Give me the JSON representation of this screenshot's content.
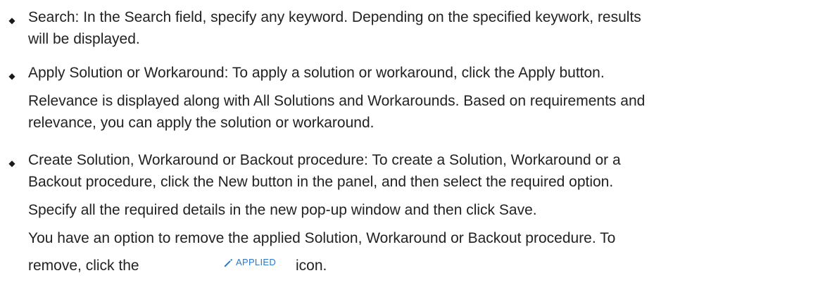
{
  "bullets": [
    {
      "lines": [
        " Search: In the Search field, specify any keyword. Depending on the specified keywork, results",
        "will be displayed."
      ]
    },
    {
      "lines": [
        "Apply Solution or Workaround: To apply a solution or workaround, click the Apply button."
      ],
      "paragraph_lines": [
        "Relevance is displayed along with All Solutions and Workarounds. Based on requirements and",
        "relevance, you can apply the solution or workaround."
      ]
    },
    {
      "lines": [
        "Create Solution, Workaround or Backout procedure: To create a Solution, Workaround or a",
        "Backout procedure, click the New button in the panel, and then select the required option."
      ],
      "paragraph_1": "Specify all the required details in the new pop-up window and then click Save.",
      "paragraph_2_line_1": "You have an option to remove the applied Solution, Workaround or Backout procedure. To",
      "paragraph_2_line_2_before": "remove, click the",
      "paragraph_2_line_2_after": "icon.",
      "applied_badge": {
        "label": "APPLIED",
        "icon": "pencil-icon",
        "color": "#2a78c8"
      }
    }
  ]
}
